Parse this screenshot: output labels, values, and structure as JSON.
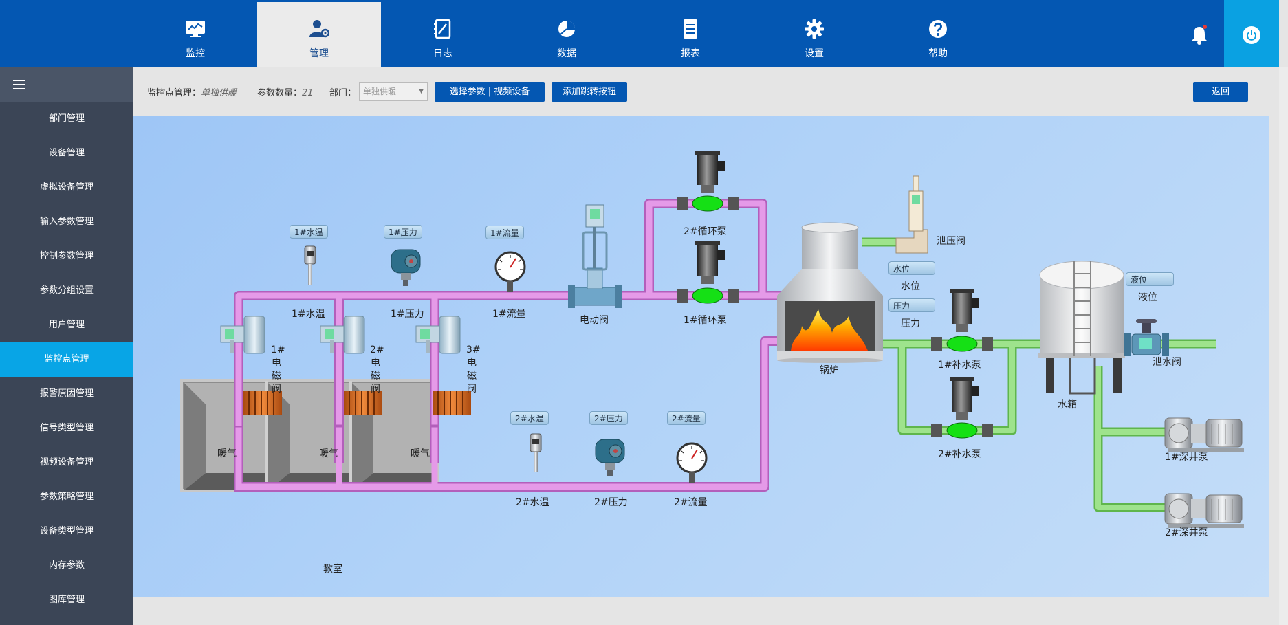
{
  "nav": {
    "items": [
      {
        "label": "监控",
        "icon": "monitor-chart-icon"
      },
      {
        "label": "管理",
        "icon": "user-gear-icon"
      },
      {
        "label": "日志",
        "icon": "notebook-pen-icon"
      },
      {
        "label": "数据",
        "icon": "pie-chart-icon"
      },
      {
        "label": "报表",
        "icon": "document-list-icon"
      },
      {
        "label": "设置",
        "icon": "gear-icon"
      },
      {
        "label": "帮助",
        "icon": "question-circle-icon"
      }
    ],
    "active_index": 1
  },
  "sidebar": {
    "items": [
      {
        "label": "部门管理"
      },
      {
        "label": "设备管理"
      },
      {
        "label": "虚拟设备管理"
      },
      {
        "label": "输入参数管理"
      },
      {
        "label": "控制参数管理"
      },
      {
        "label": "参数分组设置"
      },
      {
        "label": "用户管理"
      },
      {
        "label": "监控点管理"
      },
      {
        "label": "报警原因管理"
      },
      {
        "label": "信号类型管理"
      },
      {
        "label": "视频设备管理"
      },
      {
        "label": "参数策略管理"
      },
      {
        "label": "设备类型管理"
      },
      {
        "label": "内存参数"
      },
      {
        "label": "图库管理"
      }
    ],
    "active_index": 7
  },
  "toolbar": {
    "point_label": "监控点管理：",
    "point_value": "单独供暖",
    "param_count_label": "参数数量：",
    "param_count_value": "21",
    "dept_label": "部门：",
    "dept_select_value": "单独供暖",
    "select_params_button": "选择参数 | 视频设备",
    "add_jump_button": "添加跳转按钮",
    "back_button": "返回"
  },
  "diagram": {
    "tags": {
      "t1_temp": "1#水温",
      "t1_press": "1#压力",
      "t1_flow": "1#流量",
      "t2_temp": "2#水温",
      "t2_press": "2#压力",
      "t2_flow": "2#流量",
      "water_level": "水位",
      "pressure": "压力",
      "liquid_level": "液位"
    },
    "labels": {
      "temp1": "1#水温",
      "press1": "1#压力",
      "flow1": "1#流量",
      "motor_valve": "电动阀",
      "pump_circ2": "2#循环泵",
      "pump_circ1": "1#循环泵",
      "relief_valve": "泄压阀",
      "water_level": "水位",
      "pressure": "压力",
      "boiler": "锅炉",
      "makeup1": "1#补水泵",
      "makeup2": "2#补水泵",
      "tank": "水箱",
      "liquid_level": "液位",
      "drain_valve": "泄水阀",
      "deepwell1": "1#深井泵",
      "deepwell2": "2#深井泵",
      "temp2": "2#水温",
      "press2": "2#压力",
      "flow2": "2#流量",
      "classroom": "教室",
      "heater1": "暖气",
      "heater2": "暖气",
      "heater3": "暖气",
      "sv1_num": "1#",
      "sv1_chars": [
        "电",
        "磁",
        "阀"
      ],
      "sv2_num": "2#",
      "sv2_chars": [
        "电",
        "磁",
        "阀"
      ],
      "sv3_num": "3#",
      "sv3_chars": [
        "电",
        "磁",
        "阀"
      ]
    },
    "colors": {
      "hot_pipe": "#d98bdf",
      "cold_pipe": "#8fdb7a",
      "pump_run": "#15e015"
    }
  }
}
